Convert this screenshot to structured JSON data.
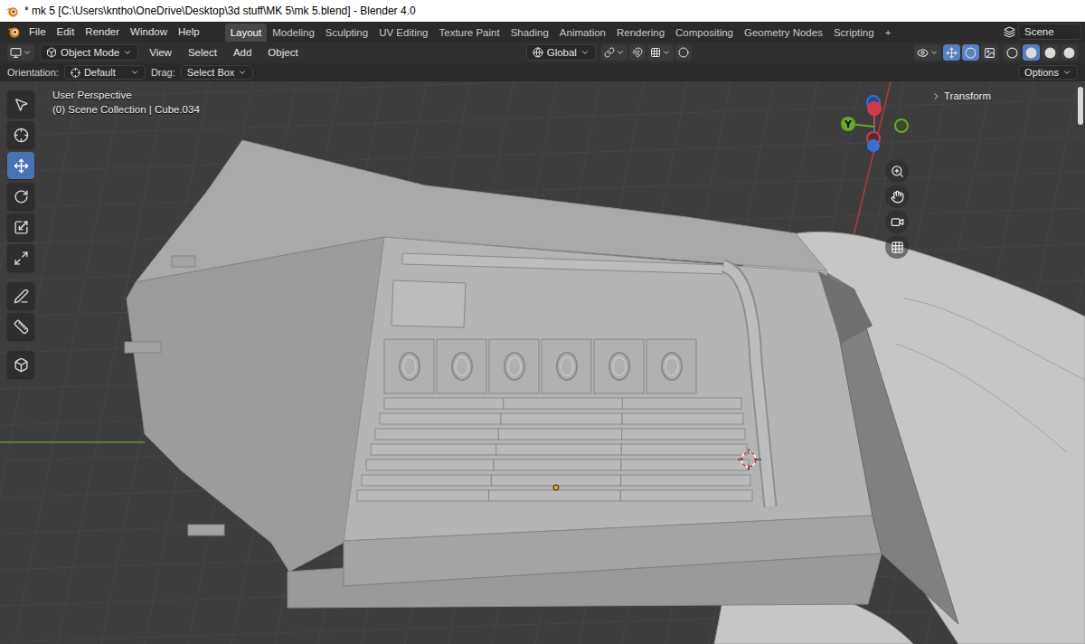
{
  "window": {
    "title": "* mk 5 [C:\\Users\\kntho\\OneDrive\\Desktop\\3d stuff\\MK 5\\mk 5.blend] - Blender 4.0"
  },
  "menu": [
    "File",
    "Edit",
    "Render",
    "Window",
    "Help"
  ],
  "workspaces": [
    {
      "label": "Layout",
      "selected": true
    },
    {
      "label": "Modeling",
      "selected": false
    },
    {
      "label": "Sculpting",
      "selected": false
    },
    {
      "label": "UV Editing",
      "selected": false
    },
    {
      "label": "Texture Paint",
      "selected": false
    },
    {
      "label": "Shading",
      "selected": false
    },
    {
      "label": "Animation",
      "selected": false
    },
    {
      "label": "Rendering",
      "selected": false
    },
    {
      "label": "Compositing",
      "selected": false
    },
    {
      "label": "Geometry Nodes",
      "selected": false
    },
    {
      "label": "Scripting",
      "selected": false
    }
  ],
  "add_workspace": "+",
  "scene": "Scene",
  "header": {
    "mode": "Object Mode",
    "menus": [
      "View",
      "Select",
      "Add",
      "Object"
    ],
    "orientation": "Global"
  },
  "tool_settings": {
    "orientation_label": "Orientation:",
    "orientation": "Default",
    "drag_label": "Drag:",
    "drag": "Select Box",
    "options": "Options"
  },
  "viewport": {
    "view": "User Perspective",
    "context": "(0) Scene Collection | Cube.034",
    "sidebar_panel": {
      "label": "Transform",
      "expanded": false
    },
    "gizmo": {
      "y_label": "Y"
    }
  },
  "tools": [
    {
      "selected": false
    },
    {
      "selected": false
    },
    {
      "selected": true
    },
    {
      "selected": false
    },
    {
      "selected": false
    },
    {
      "selected": false
    },
    {
      "selected": false
    },
    {
      "selected": false
    },
    {
      "selected": false
    }
  ],
  "shading": [
    {
      "selected": false
    },
    {
      "selected": true
    },
    {
      "selected": false
    },
    {
      "selected": false
    }
  ]
}
